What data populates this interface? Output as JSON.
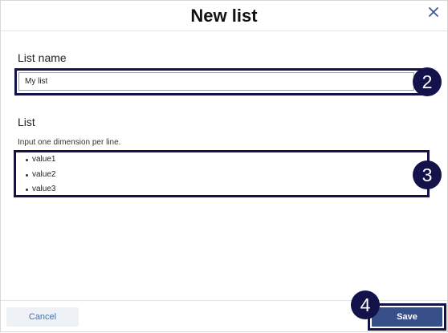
{
  "dialog": {
    "title": "New list",
    "close_icon": "close-icon"
  },
  "list_name": {
    "label": "List name",
    "value": "My list"
  },
  "list": {
    "label": "List",
    "hint": "Input one dimension per line.",
    "items": [
      "value1",
      "value2",
      "value3"
    ]
  },
  "callouts": {
    "name": "2",
    "list": "3",
    "save": "4"
  },
  "footer": {
    "cancel_label": "Cancel",
    "save_label": "Save"
  },
  "colors": {
    "accent": "#37508a",
    "callout": "#13124a",
    "cancel_text": "#4a6fa5"
  }
}
